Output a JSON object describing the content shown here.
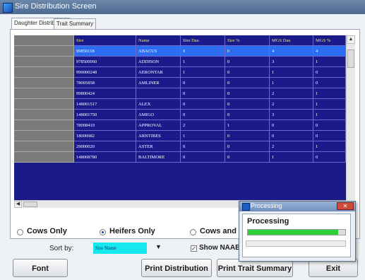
{
  "window": {
    "title": "Sire Distribution Screen"
  },
  "tabs": [
    {
      "label": "Daughter Distribution"
    },
    {
      "label": "Trait Summary"
    }
  ],
  "grid": {
    "columns": [
      "Sire",
      "Name",
      "Sire Dau",
      "Sire %",
      "MGS Dau",
      "MGS %"
    ],
    "selected_row": 0,
    "rows": [
      [
        "99850118",
        "ABACUS",
        "0",
        "0",
        "4",
        "4"
      ],
      [
        "978500060",
        "ADDISON",
        "1",
        "0",
        "3",
        "1"
      ],
      [
        "999000248",
        "AERONTAR",
        "1",
        "0",
        "1",
        "0"
      ],
      [
        "78005858",
        "AMLINER",
        "0",
        "0",
        "1",
        "0"
      ],
      [
        "99800424",
        "",
        "0",
        "0",
        "2",
        "1"
      ],
      [
        "148001517",
        "ALEX",
        "0",
        "0",
        "2",
        "1"
      ],
      [
        "148001750",
        "AMIGO",
        "0",
        "0",
        "3",
        "1"
      ],
      [
        "78008419",
        "APPROVAL",
        "2",
        "1",
        "0",
        "0"
      ],
      [
        "18000982",
        "ARNTIBES",
        "1",
        "0",
        "0",
        "0"
      ],
      [
        "29000020",
        "ASTER",
        "0",
        "0",
        "2",
        "1"
      ],
      [
        "148008780",
        "BALTIMORE",
        "0",
        "0",
        "1",
        "0"
      ]
    ]
  },
  "options": {
    "radio_cows": "Cows Only",
    "radio_heifers": "Heifers Only",
    "radio_cows_and": "Cows and",
    "selected": "heifers"
  },
  "sort": {
    "label": "Sort by:",
    "value": "Sire Name"
  },
  "show_naab": {
    "label": "Show NAAB",
    "checked": true
  },
  "buttons": {
    "font": "Font",
    "print_distribution": "Print Distribution",
    "print_trait_summary": "Print Trait Summary",
    "exit": "Exit"
  },
  "processing": {
    "title": "Processing",
    "label": "Processing",
    "progress": 0.93
  }
}
